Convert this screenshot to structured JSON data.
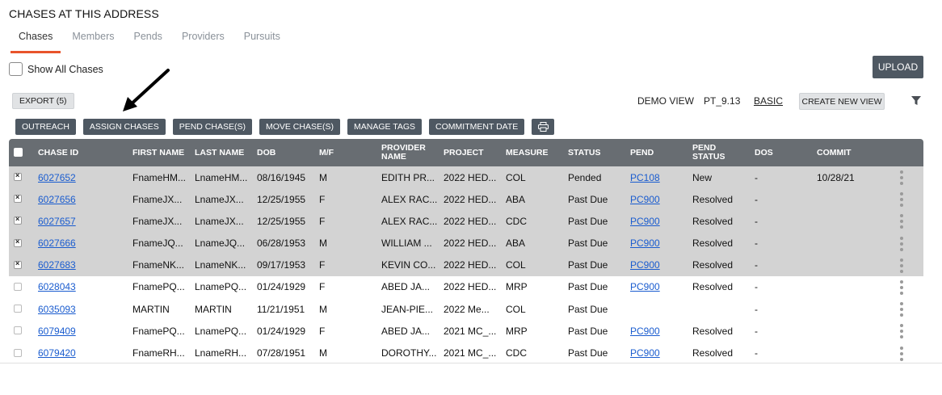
{
  "page_title": "CHASES AT THIS ADDRESS",
  "tabs": [
    {
      "label": "Chases"
    },
    {
      "label": "Members"
    },
    {
      "label": "Pends"
    },
    {
      "label": "Providers"
    },
    {
      "label": "Pursuits"
    }
  ],
  "show_all_label": "Show All Chases",
  "upload_label": "UPLOAD",
  "export_label": "EXPORT (5)",
  "view": {
    "demo_view": "DEMO VIEW",
    "name": "PT_9.13",
    "basic": "BASIC",
    "create_label": "CREATE NEW VIEW"
  },
  "actions": [
    "OUTREACH",
    "ASSIGN CHASES",
    "PEND CHASE(S)",
    "MOVE CHASE(S)",
    "MANAGE TAGS",
    "COMMITMENT DATE"
  ],
  "columns": [
    "CHASE ID",
    "FIRST NAME",
    "LAST NAME",
    "DOB",
    "M/F",
    "PROVIDER NAME",
    "PROJECT",
    "MEASURE",
    "STATUS",
    "PEND",
    "PEND STATUS",
    "DOS",
    "COMMIT"
  ],
  "rows": [
    {
      "selected": true,
      "chase_id": "6027652",
      "first": "FnameHM...",
      "last": "LnameHM...",
      "dob": "08/16/1945",
      "mf": "M",
      "provider": "EDITH PR...",
      "project": "2022 HED...",
      "measure": "COL",
      "status": "Pended",
      "pend": "PC108",
      "pend_status": "New",
      "dos": "-",
      "commit": "10/28/21"
    },
    {
      "selected": true,
      "chase_id": "6027656",
      "first": "FnameJX...",
      "last": "LnameJX...",
      "dob": "12/25/1955",
      "mf": "F",
      "provider": "ALEX RAC...",
      "project": "2022 HED...",
      "measure": "ABA",
      "status": "Past Due",
      "pend": "PC900",
      "pend_status": "Resolved",
      "dos": "-",
      "commit": ""
    },
    {
      "selected": true,
      "chase_id": "6027657",
      "first": "FnameJX...",
      "last": "LnameJX...",
      "dob": "12/25/1955",
      "mf": "F",
      "provider": "ALEX RAC...",
      "project": "2022 HED...",
      "measure": "CDC",
      "status": "Past Due",
      "pend": "PC900",
      "pend_status": "Resolved",
      "dos": "-",
      "commit": ""
    },
    {
      "selected": true,
      "chase_id": "6027666",
      "first": "FnameJQ...",
      "last": "LnameJQ...",
      "dob": "06/28/1953",
      "mf": "M",
      "provider": "WILLIAM ...",
      "project": "2022 HED...",
      "measure": "ABA",
      "status": "Past Due",
      "pend": "PC900",
      "pend_status": "Resolved",
      "dos": "-",
      "commit": ""
    },
    {
      "selected": true,
      "chase_id": "6027683",
      "first": "FnameNK...",
      "last": "LnameNK...",
      "dob": "09/17/1953",
      "mf": "F",
      "provider": "KEVIN CO...",
      "project": "2022 HED...",
      "measure": "COL",
      "status": "Past Due",
      "pend": "PC900",
      "pend_status": "Resolved",
      "dos": "-",
      "commit": ""
    },
    {
      "selected": false,
      "chase_id": "6028043",
      "first": "FnamePQ...",
      "last": "LnamePQ...",
      "dob": "01/24/1929",
      "mf": "F",
      "provider": "ABED JA...",
      "project": "2022 HED...",
      "measure": "MRP",
      "status": "Past Due",
      "pend": "PC900",
      "pend_status": "Resolved",
      "dos": "-",
      "commit": ""
    },
    {
      "selected": false,
      "chase_id": "6035093",
      "first": "MARTIN",
      "last": "MARTIN",
      "dob": "11/21/1951",
      "mf": "M",
      "provider": "JEAN-PIE...",
      "project": "2022 Me...",
      "measure": "COL",
      "status": "Past Due",
      "pend": "",
      "pend_status": "",
      "dos": "-",
      "commit": ""
    },
    {
      "selected": false,
      "chase_id": "6079409",
      "first": "FnamePQ...",
      "last": "LnamePQ...",
      "dob": "01/24/1929",
      "mf": "F",
      "provider": "ABED JA...",
      "project": "2021 MC_...",
      "measure": "MRP",
      "status": "Past Due",
      "pend": "PC900",
      "pend_status": "Resolved",
      "dos": "-",
      "commit": ""
    },
    {
      "selected": false,
      "chase_id": "6079420",
      "first": "FnameRH...",
      "last": "LnameRH...",
      "dob": "07/28/1951",
      "mf": "M",
      "provider": "DOROTHY...",
      "project": "2021 MC_...",
      "measure": "CDC",
      "status": "Past Due",
      "pend": "PC900",
      "pend_status": "Resolved",
      "dos": "-",
      "commit": ""
    }
  ],
  "icons": {
    "filter": "filter-icon",
    "print": "print-icon",
    "kebab": "kebab-menu-icon",
    "annotation": "arrow-annotation"
  },
  "colors": {
    "accent": "#e8542b",
    "button_dark": "#4e5862",
    "header": "#686d72",
    "selected_row": "#d3d3d3",
    "link": "#1a5ccf"
  }
}
